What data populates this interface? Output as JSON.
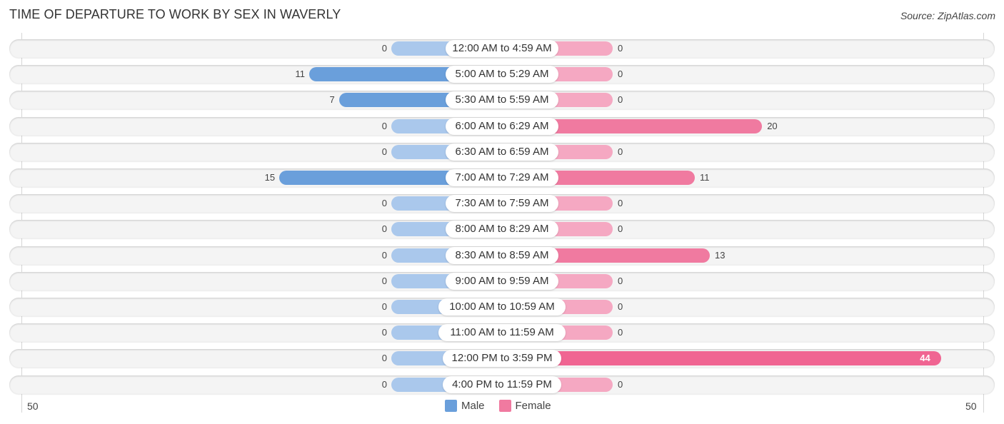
{
  "title": "TIME OF DEPARTURE TO WORK BY SEX IN WAVERLY",
  "source": "Source: ZipAtlas.com",
  "colors": {
    "male": "#6a9fdb",
    "female": "#f07aa0",
    "male_zero": "#aac8ec",
    "female_zero": "#f5a8c2"
  },
  "chart_data": {
    "type": "bar",
    "orientation": "horizontal-diverging",
    "title": "TIME OF DEPARTURE TO WORK BY SEX IN WAVERLY",
    "categories": [
      "12:00 AM to 4:59 AM",
      "5:00 AM to 5:29 AM",
      "5:30 AM to 5:59 AM",
      "6:00 AM to 6:29 AM",
      "6:30 AM to 6:59 AM",
      "7:00 AM to 7:29 AM",
      "7:30 AM to 7:59 AM",
      "8:00 AM to 8:29 AM",
      "8:30 AM to 8:59 AM",
      "9:00 AM to 9:59 AM",
      "10:00 AM to 10:59 AM",
      "11:00 AM to 11:59 AM",
      "12:00 PM to 3:59 PM",
      "4:00 PM to 11:59 PM"
    ],
    "series": [
      {
        "name": "Male",
        "values": [
          0,
          11,
          7,
          0,
          0,
          15,
          0,
          0,
          0,
          0,
          0,
          0,
          0,
          0
        ]
      },
      {
        "name": "Female",
        "values": [
          0,
          0,
          0,
          20,
          0,
          11,
          0,
          0,
          13,
          0,
          0,
          0,
          44,
          0
        ]
      }
    ],
    "axis": {
      "left_tick": "50",
      "right_tick": "50",
      "max": 50
    },
    "legend": {
      "position": "bottom-center",
      "entries": [
        "Male",
        "Female"
      ]
    }
  }
}
